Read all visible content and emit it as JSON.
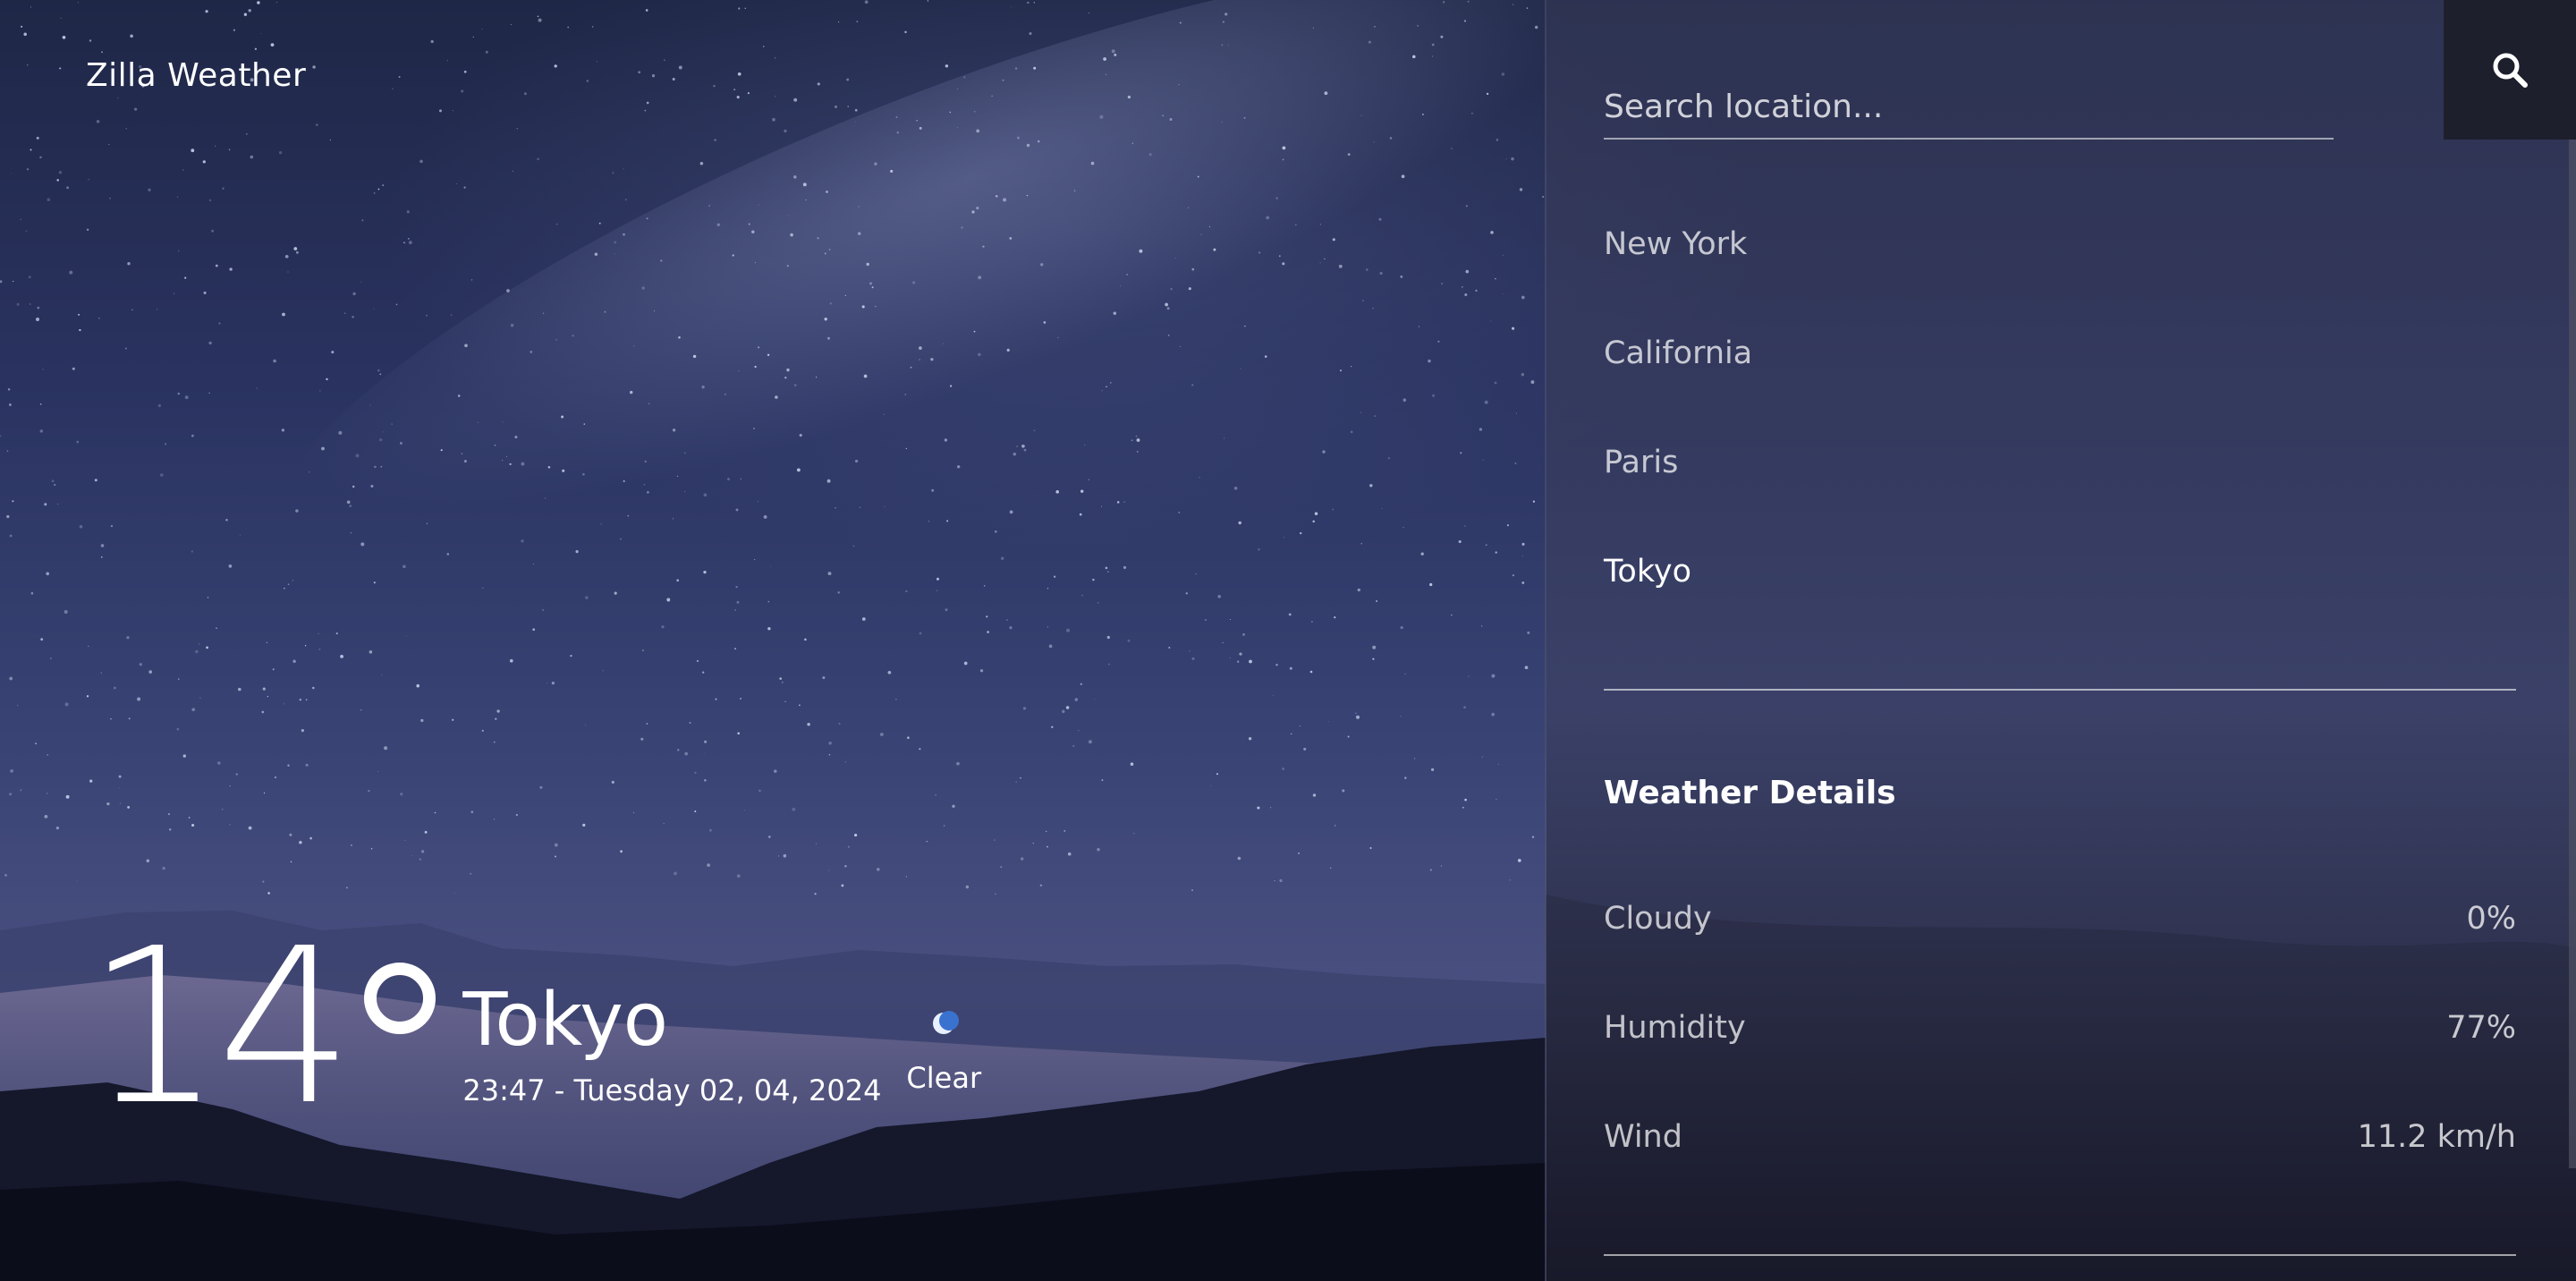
{
  "brand": "Zilla Weather",
  "current": {
    "temperature": "14",
    "city": "Tokyo",
    "datetime": "23:47 - Tuesday 02, 04, 2024",
    "condition": "Clear",
    "condition_icon": "moon-icon"
  },
  "search": {
    "placeholder": "Search location...",
    "button_icon": "search-icon"
  },
  "locations": [
    "New York",
    "California",
    "Paris",
    "Tokyo"
  ],
  "active_location": "Tokyo",
  "details": {
    "title": "Weather Details",
    "rows": [
      {
        "label": "Cloudy",
        "value": "0%"
      },
      {
        "label": "Humidity",
        "value": "77%"
      },
      {
        "label": "Wind",
        "value": "11.2 km/h"
      }
    ]
  },
  "colors": {
    "panel": "#3e4262",
    "search_button": "#1d1f2d",
    "sky_top": "#1f2747",
    "sky_bottom": "#262a45"
  }
}
